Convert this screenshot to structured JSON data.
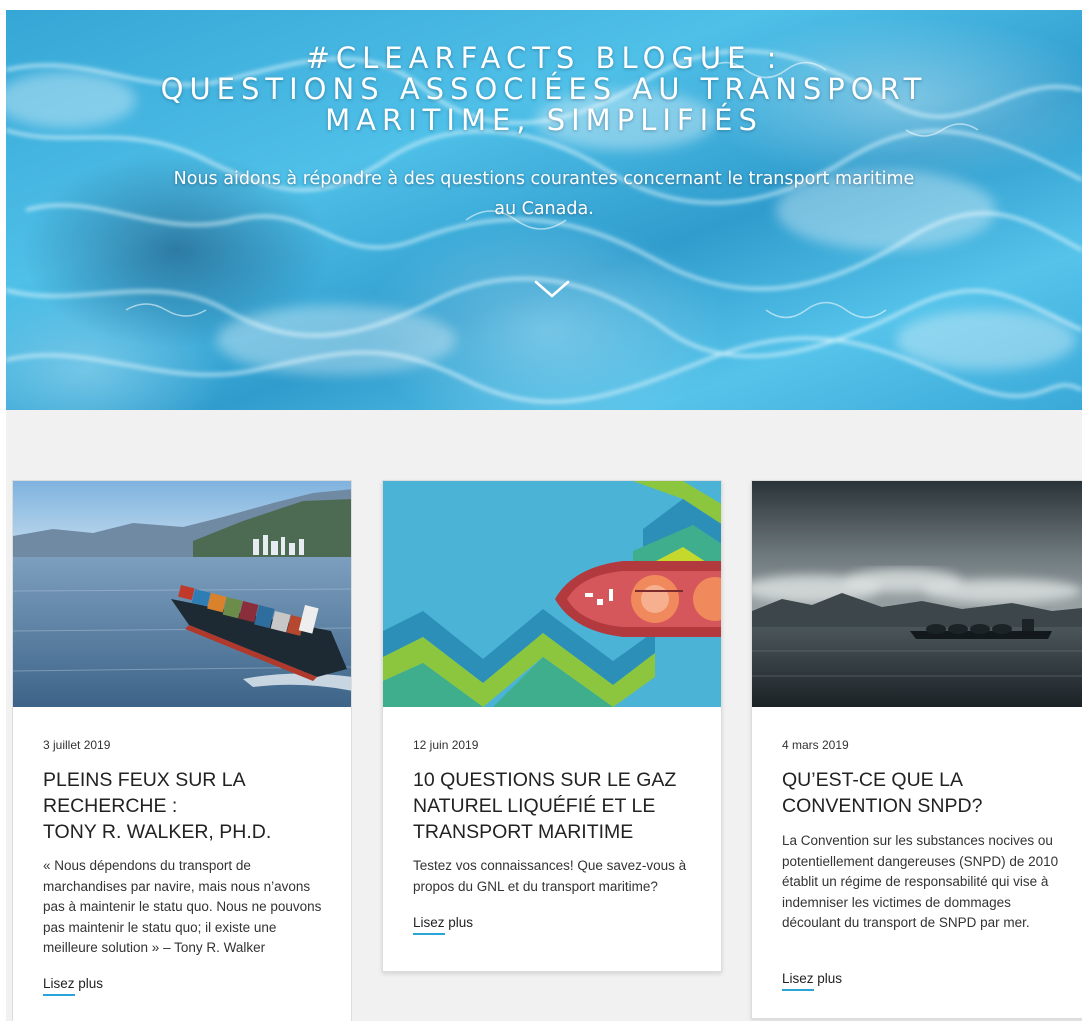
{
  "hero": {
    "title_lines": [
      "#CLEARFACTS BLOGUE :",
      "QUESTIONS ASSOCIÉES AU TRANSPORT",
      "MARITIME, SIMPLIFIÉS"
    ],
    "subtitle": "Nous aidons à répondre à des questions courantes concernant le transport maritime au Canada.",
    "scroll_icon": "chevron-down-icon"
  },
  "colors": {
    "accent": "#2aa5d9",
    "section_background": "#f1f1f1",
    "card_background": "#ffffff",
    "text_dark": "#222222"
  },
  "cards": [
    {
      "date": "3 juillet 2019",
      "title_lines": [
        "PLEINS FEUX SUR LA",
        "RECHERCHE :",
        "TONY R. WALKER, PH.D."
      ],
      "excerpt": "« Nous dépendons du transport de marchandises par navire, mais nous n’avons pas à maintenir le statu quo. Nous ne pouvons pas maintenir le statu quo; il existe une meilleure solution » – Tony R. Walker",
      "link_word_1": "Lisez",
      "link_word_2": "plus"
    },
    {
      "date": "12 juin 2019",
      "title_lines": [
        "10 QUESTIONS SUR LE GAZ",
        "NATUREL LIQUÉFIÉ ET LE",
        "TRANSPORT MARITIME"
      ],
      "excerpt": "Testez vos connaissances! Que savez-vous à propos du GNL et du transport maritime?",
      "link_word_1": "Lisez",
      "link_word_2": "plus"
    },
    {
      "date": "4 mars 2019",
      "title_lines": [
        "QU’EST-CE QUE LA",
        "CONVENTION SNPD?"
      ],
      "excerpt": "La Convention sur les substances nocives ou potentiellement dangereuses (SNPD) de 2010 établit un régime de responsabilité qui vise à indemniser les victimes de dommages découlant du transport de SNPD par mer.",
      "link_word_1": "Lisez",
      "link_word_2": "plus"
    }
  ]
}
